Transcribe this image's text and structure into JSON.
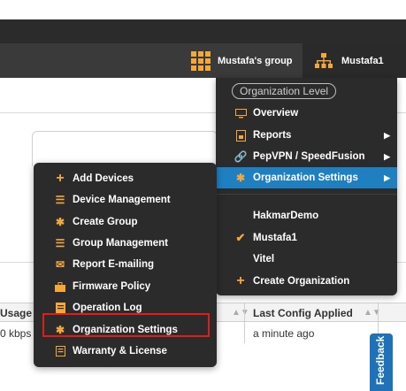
{
  "header": {
    "group_name": "Mustafa's group",
    "org_name": "Mustafa1"
  },
  "org_menu": {
    "level_label": "Organization Level",
    "items": [
      {
        "label": "Overview",
        "icon": "monitor-icon"
      },
      {
        "label": "Reports",
        "icon": "report-icon"
      },
      {
        "label": "PepVPN / SpeedFusion",
        "icon": "link-icon"
      },
      {
        "label": "Organization Settings",
        "icon": "gear-icon"
      }
    ],
    "orgs": [
      "HakmarDemo",
      "Mustafa1",
      "Vitel"
    ],
    "create_label": "Create Organization"
  },
  "device_menu": {
    "items": [
      {
        "label": "Add Devices",
        "icon": "plus-icon"
      },
      {
        "label": "Device Management",
        "icon": "list-icon"
      },
      {
        "label": "Create Group",
        "icon": "gear-icon"
      },
      {
        "label": "Group Management",
        "icon": "list-icon"
      },
      {
        "label": "Report E-mailing",
        "icon": "envelope-icon"
      },
      {
        "label": "Firmware Policy",
        "icon": "briefcase-icon"
      },
      {
        "label": "Operation Log",
        "icon": "log-icon"
      },
      {
        "label": "Organization Settings",
        "icon": "gear-icon"
      },
      {
        "label": "Warranty & License",
        "icon": "certificate-icon"
      }
    ]
  },
  "table": {
    "col_usage": "Usage",
    "col_config": "Last Config Applied",
    "row_usage": "0 kbps",
    "row_config": "a minute ago"
  },
  "feedback_label": "Feedback",
  "colors": {
    "accent": "#f4a83a",
    "highlight": "#1e7fc1",
    "menu_bg": "#2b2b2b",
    "callout": "#e21b1b"
  }
}
